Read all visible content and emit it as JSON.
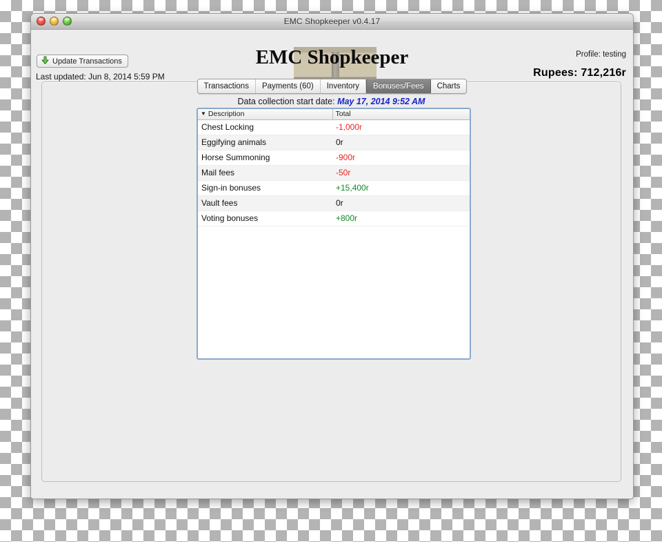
{
  "window": {
    "title": "EMC Shopkeeper v0.4.17",
    "traffic_lights": [
      "close",
      "minimize",
      "zoom"
    ]
  },
  "header": {
    "app_title": "EMC Shopkeeper",
    "update_button": {
      "label": "Update Transactions",
      "icon": "green-down-arrow-icon"
    },
    "last_updated": "Last updated: Jun 8, 2014 5:59 PM",
    "profile": "Profile: testing",
    "rupees": "Rupees:  712,216r"
  },
  "tabs": [
    {
      "label": "Transactions",
      "selected": false
    },
    {
      "label": "Payments (60)",
      "selected": false
    },
    {
      "label": "Inventory",
      "selected": false
    },
    {
      "label": "Bonuses/Fees",
      "selected": true
    },
    {
      "label": "Charts",
      "selected": false
    }
  ],
  "panel": {
    "collection_label": "Data collection start date:",
    "collection_date": "May 17, 2014 9:52 AM"
  },
  "table": {
    "sort_indicator": "▼",
    "columns": [
      "Description",
      "Total"
    ],
    "rows": [
      {
        "description": "Chest Locking",
        "total": "-1,000r",
        "sign": "neg"
      },
      {
        "description": "Eggifying animals",
        "total": "0r",
        "sign": "zero"
      },
      {
        "description": "Horse Summoning",
        "total": "-900r",
        "sign": "neg"
      },
      {
        "description": "Mail fees",
        "total": "-50r",
        "sign": "neg"
      },
      {
        "description": "Sign-in bonuses",
        "total": "+15,400r",
        "sign": "pos"
      },
      {
        "description": "Vault fees",
        "total": "0r",
        "sign": "zero"
      },
      {
        "description": "Voting bonuses",
        "total": "+800r",
        "sign": "pos"
      }
    ]
  },
  "colors": {
    "negative": "#e8231c",
    "positive": "#0a8a27",
    "date_link": "#1b23c8",
    "tab_selected_bg": "#7d7d7d",
    "table_focus_border": "#8aa9cc"
  }
}
